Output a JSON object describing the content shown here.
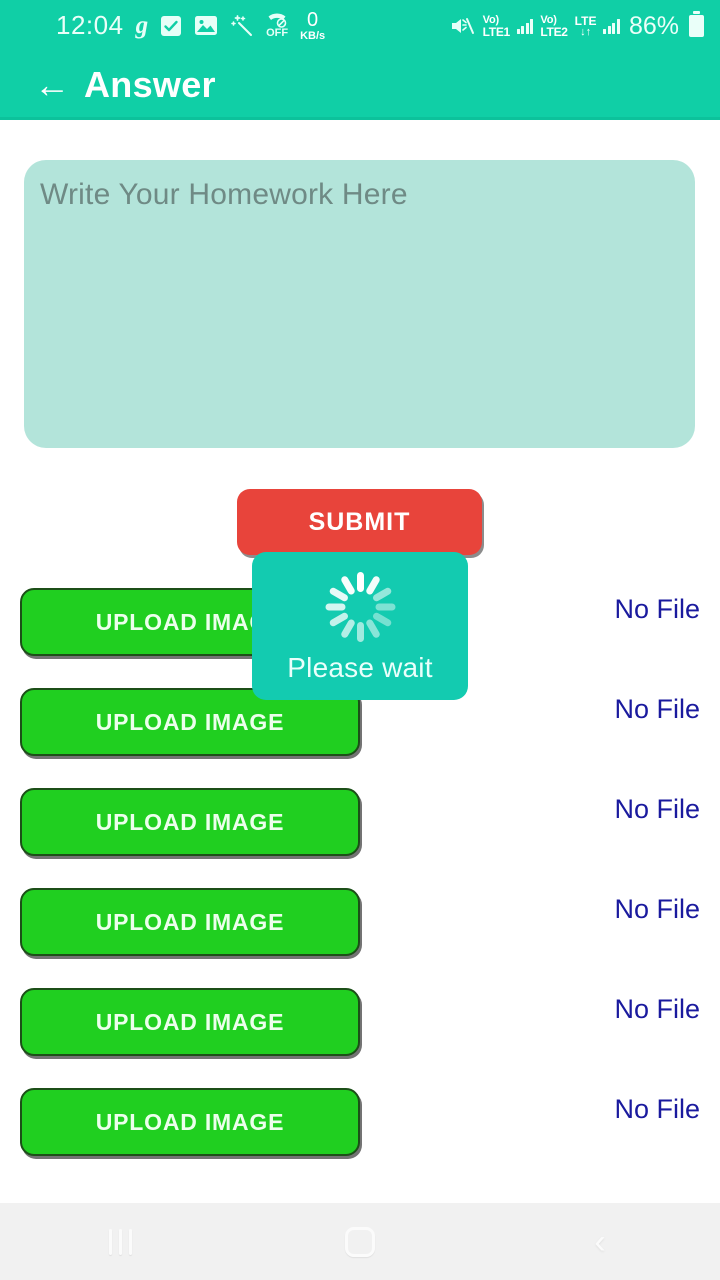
{
  "status_bar": {
    "time": "12:04",
    "icons": [
      {
        "name": "g-app-icon",
        "glyph": "g"
      },
      {
        "name": "checkbox-checked-icon",
        "glyph": "☑"
      },
      {
        "name": "gallery-image-icon",
        "glyph": "ὛC"
      },
      {
        "name": "magic-wand-icon",
        "glyph": "✦"
      }
    ],
    "call_off_label": "OFF",
    "data_speed_value": "0",
    "data_speed_unit": "KB/s",
    "mute_icon": "mute-icon",
    "sim1": {
      "volte": "Vo)",
      "name": "LTE1"
    },
    "sim2": {
      "volte": "Vo)",
      "name": "LTE2"
    },
    "network_type": "LTE",
    "network_arrows": "↓↑",
    "battery_percent": "86%",
    "bar_background": "#10CFA6"
  },
  "appbar": {
    "back_label": "←",
    "title": "Answer",
    "background": "#10CFA6"
  },
  "answer_field": {
    "placeholder": "Write Your Homework Here",
    "value": "",
    "background": "#b3e4da"
  },
  "submit": {
    "label": "SUBMIT",
    "color": "#e8443b"
  },
  "uploads": {
    "button_label": "UPLOAD IMAGE",
    "rows": [
      {
        "label": "UPLOAD IMAGE",
        "status": "No File"
      },
      {
        "label": "UPLOAD IMAGE",
        "status": "No File"
      },
      {
        "label": "UPLOAD IMAGE",
        "status": "No File"
      },
      {
        "label": "UPLOAD IMAGE",
        "status": "No File"
      },
      {
        "label": "UPLOAD IMAGE",
        "status": "No File"
      },
      {
        "label": "UPLOAD IMAGE",
        "status": "No File"
      }
    ],
    "button_color": "#20cf20",
    "status_color": "#1a1a9e"
  },
  "dialog": {
    "message": "Please wait",
    "spinner": "loading-spinner-icon",
    "background": "#13cbb0"
  },
  "navbar": {
    "recents": "recents-icon",
    "home": "home-icon",
    "back": "‹"
  }
}
